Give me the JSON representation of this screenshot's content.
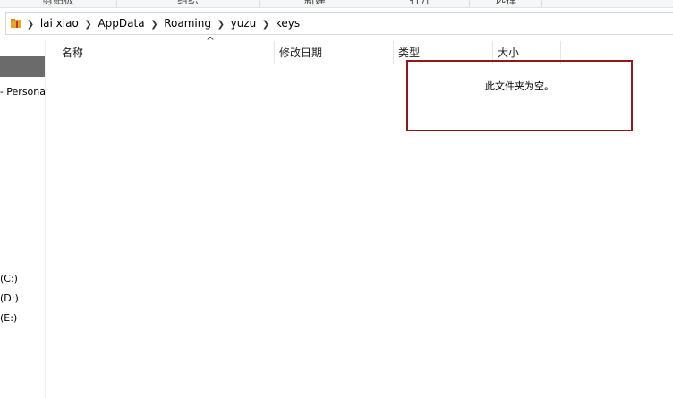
{
  "ribbon": {
    "groups": [
      "剪贴板",
      "组织",
      "新建",
      "打开",
      "选择"
    ]
  },
  "address": {
    "crumbs": [
      "lai xiao",
      "AppData",
      "Roaming",
      "yuzu",
      "keys"
    ]
  },
  "nav": {
    "items": [
      "- Persona",
      "(C:)",
      "(D:)",
      "(E:)"
    ]
  },
  "columns": {
    "name": "名称",
    "date_modified": "修改日期",
    "type": "类型",
    "size": "大小"
  },
  "empty_message": "此文件夹为空。",
  "colors": {
    "highlight_border": "#8b1a1a",
    "nav_selected": "#6b6b6b",
    "folder_icon": "#e8a628"
  }
}
